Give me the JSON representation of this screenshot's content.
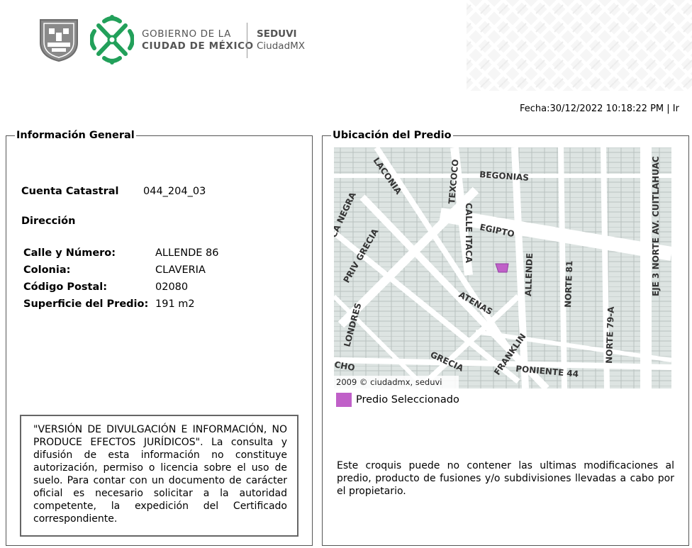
{
  "header": {
    "gov_line1": "GOBIERNO DE LA",
    "gov_line2": "CIUDAD DE MÉXICO",
    "seduvi_line1": "SEDUVI",
    "seduvi_line2": "CiudadMX",
    "fecha": "Fecha:30/12/2022 10:18:22 PM | Ir"
  },
  "colors": {
    "cdmx_green": "#22a05a",
    "shield_gray": "#8a8a8a",
    "predio_color": "#c060c8"
  },
  "info_general": {
    "legend": "Información General",
    "cuenta_label": "Cuenta Catastral",
    "cuenta_value": "044_204_03",
    "direccion_label": "Dirección",
    "calle_label": "Calle y Número:",
    "calle_value": "ALLENDE 86",
    "colonia_label": "Colonia:",
    "colonia_value": "CLAVERIA",
    "cp_label": "Código Postal:",
    "cp_value": "02080",
    "superficie_label": "Superficie del Predio:",
    "superficie_value": "191 m2",
    "disclaimer": "\"VERSIÓN DE DIVULGACIÓN E INFORMACIÓN, NO PRODUCE EFECTOS JURÍDICOS\". La consulta y difusión de esta información no constituye autorización, permiso o licencia sobre el uso de suelo. Para contar con un documento de carácter oficial es necesario solicitar a la autoridad competente, la expedición del Certificado correspondiente."
  },
  "ubicacion": {
    "legend": "Ubicación del Predio",
    "copyright": "2009 © ciudadmx, seduvi",
    "streets": [
      "LACONIA",
      "TEXCOCO",
      "BEGONIAS",
      "EJE 3 NORTE AV. CUITLAHUAC",
      "CALLE ITACA",
      "EGIPTO",
      "CA NEGRA",
      "PRIV GRECIA",
      "ALLENDE",
      "NORTE 81",
      "ATENAS",
      "LONDRES",
      "NORTE 79-A",
      "FRANKLIN",
      "GRECIA",
      "PONIENTE 44",
      "CHO"
    ],
    "legend_label": "Predio Seleccionado",
    "note": "Este croquis puede no contener las ultimas modificaciones al predio, producto de fusiones y/o subdivisiones llevadas a cabo por el propietario."
  }
}
